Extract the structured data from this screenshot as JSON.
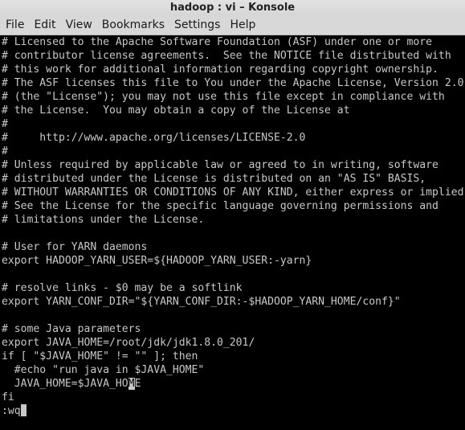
{
  "window": {
    "title": "hadoop : vi – Konsole"
  },
  "menubar": {
    "items": [
      "File",
      "Edit",
      "View",
      "Bookmarks",
      "Settings",
      "Help"
    ]
  },
  "terminal": {
    "lines": [
      "# Licensed to the Apache Software Foundation (ASF) under one or more",
      "# contributor license agreements.  See the NOTICE file distributed with",
      "# this work for additional information regarding copyright ownership.",
      "# The ASF licenses this file to You under the Apache License, Version 2.0",
      "# (the \"License\"); you may not use this file except in compliance with",
      "# the License.  You may obtain a copy of the License at",
      "#",
      "#     http://www.apache.org/licenses/LICENSE-2.0",
      "#",
      "# Unless required by applicable law or agreed to in writing, software",
      "# distributed under the License is distributed on an \"AS IS\" BASIS,",
      "# WITHOUT WARRANTIES OR CONDITIONS OF ANY KIND, either express or implied.",
      "# See the License for the specific language governing permissions and",
      "# limitations under the License.",
      "",
      "# User for YARN daemons",
      "export HADOOP_YARN_USER=${HADOOP_YARN_USER:-yarn}",
      "",
      "# resolve links - $0 may be a softlink",
      "export YARN_CONF_DIR=\"${YARN_CONF_DIR:-$HADOOP_YARN_HOME/conf}\"",
      "",
      "# some Java parameters",
      "export JAVA_HOME=/root/jdk/jdk1.8.0_201/",
      "if [ \"$JAVA_HOME\" != \"\" ]; then",
      "  #echo \"run java in $JAVA_HOME\"",
      "fi"
    ],
    "cursor_line": {
      "before": "  JAVA_HOME=$JAVA_HO",
      "under_cursor": "M",
      "after": "E"
    },
    "command_line": ":wq"
  }
}
